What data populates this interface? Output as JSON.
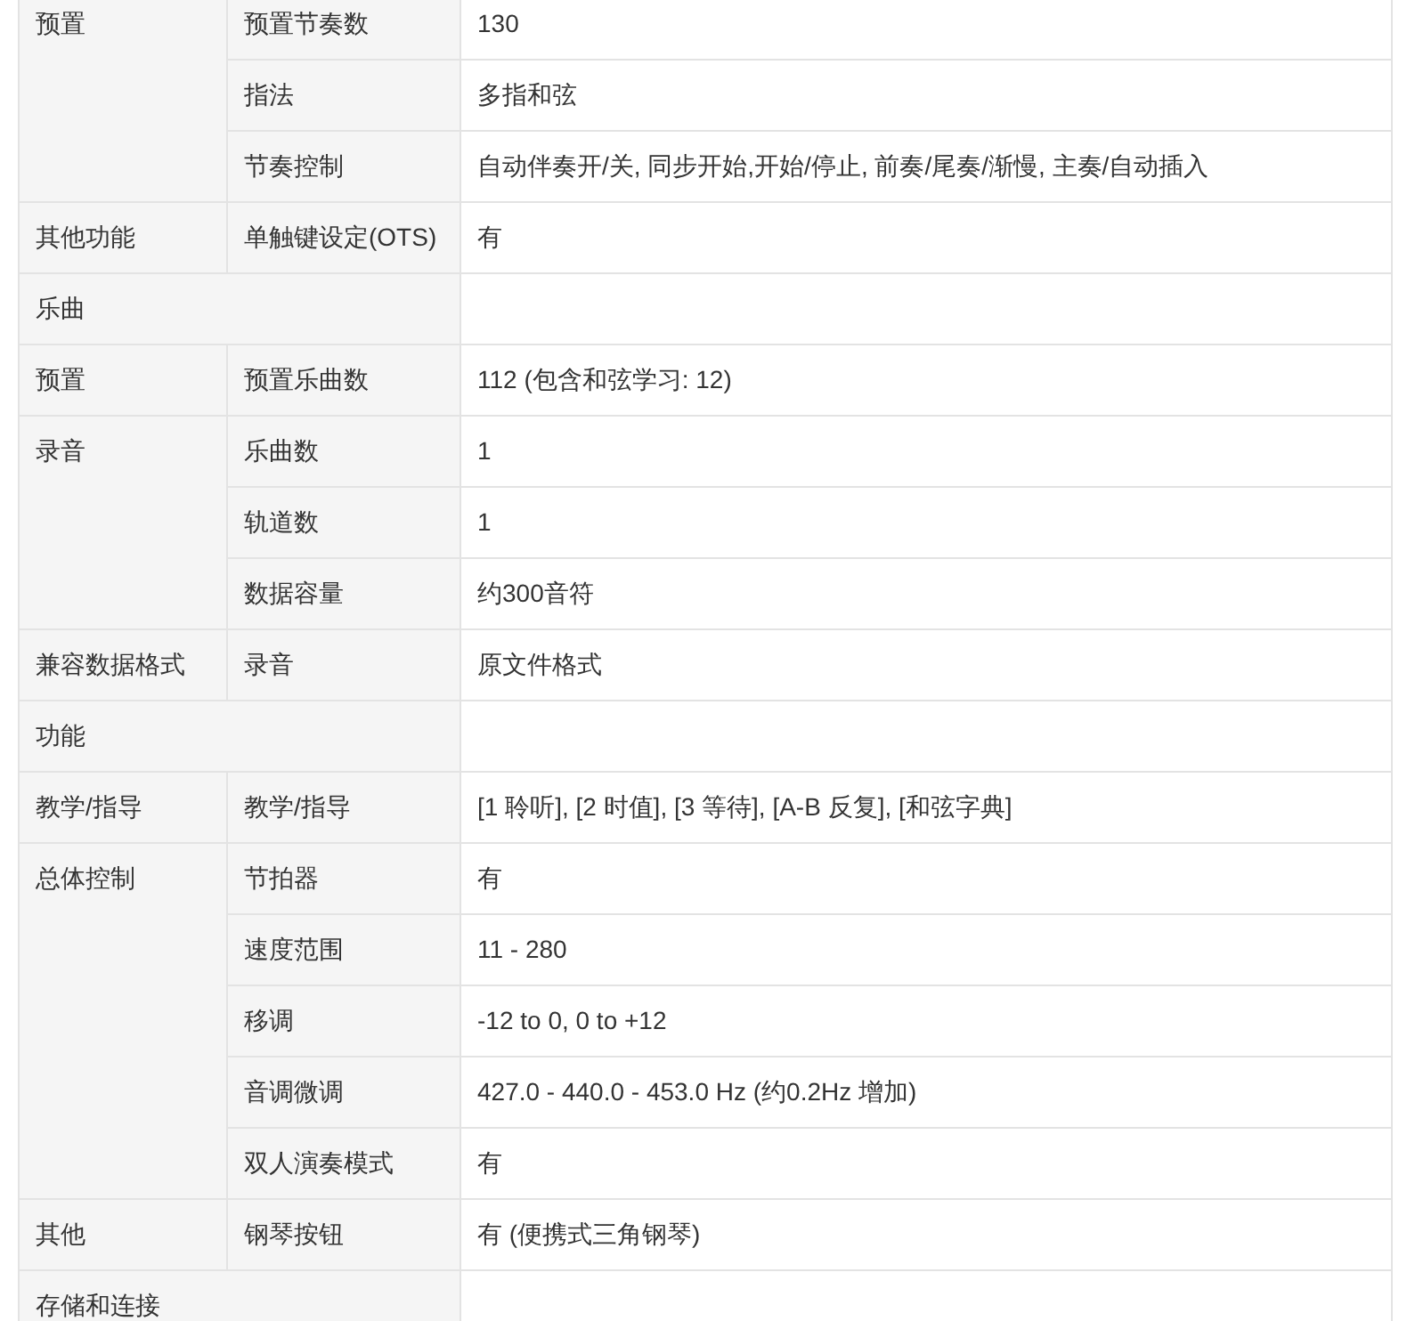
{
  "spec_table": [
    {
      "kind": "group",
      "label": "预置",
      "items": [
        {
          "label": "预置节奏数",
          "value": "130"
        },
        {
          "label": "指法",
          "value": "多指和弦"
        },
        {
          "label": "节奏控制",
          "value": "自动伴奏开/关, 同步开始,开始/停止, 前奏/尾奏/渐慢, 主奏/自动插入"
        }
      ]
    },
    {
      "kind": "group",
      "label": "其他功能",
      "items": [
        {
          "label": "单触键设定(OTS)",
          "value": "有"
        }
      ]
    },
    {
      "kind": "section",
      "label": "乐曲"
    },
    {
      "kind": "group",
      "label": "预置",
      "items": [
        {
          "label": "预置乐曲数",
          "value": "112 (包含和弦学习: 12)"
        }
      ]
    },
    {
      "kind": "group",
      "label": "录音",
      "items": [
        {
          "label": "乐曲数",
          "value": "1"
        },
        {
          "label": "轨道数",
          "value": "1"
        },
        {
          "label": "数据容量",
          "value": "约300音符"
        }
      ]
    },
    {
      "kind": "group",
      "label": "兼容数据格式",
      "items": [
        {
          "label": "录音",
          "value": "原文件格式"
        }
      ]
    },
    {
      "kind": "section",
      "label": "功能"
    },
    {
      "kind": "group",
      "label": "教学/指导",
      "items": [
        {
          "label": "教学/指导",
          "value": "[1 聆听], [2 时值], [3 等待], [A-B 反复], [和弦字典]"
        }
      ]
    },
    {
      "kind": "group",
      "label": "总体控制",
      "items": [
        {
          "label": "节拍器",
          "value": "有"
        },
        {
          "label": "速度范围",
          "value": "11 - 280"
        },
        {
          "label": "移调",
          "value": "-12 to 0, 0 to +12"
        },
        {
          "label": "音调微调",
          "value": "427.0 - 440.0 - 453.0 Hz (约0.2Hz 增加)"
        },
        {
          "label": "双人演奏模式",
          "value": "有"
        }
      ]
    },
    {
      "kind": "group",
      "label": "其他",
      "items": [
        {
          "label": "钢琴按钮",
          "value": "有 (便携式三角钢琴)"
        }
      ]
    },
    {
      "kind": "section",
      "label": "存储和连接"
    }
  ]
}
